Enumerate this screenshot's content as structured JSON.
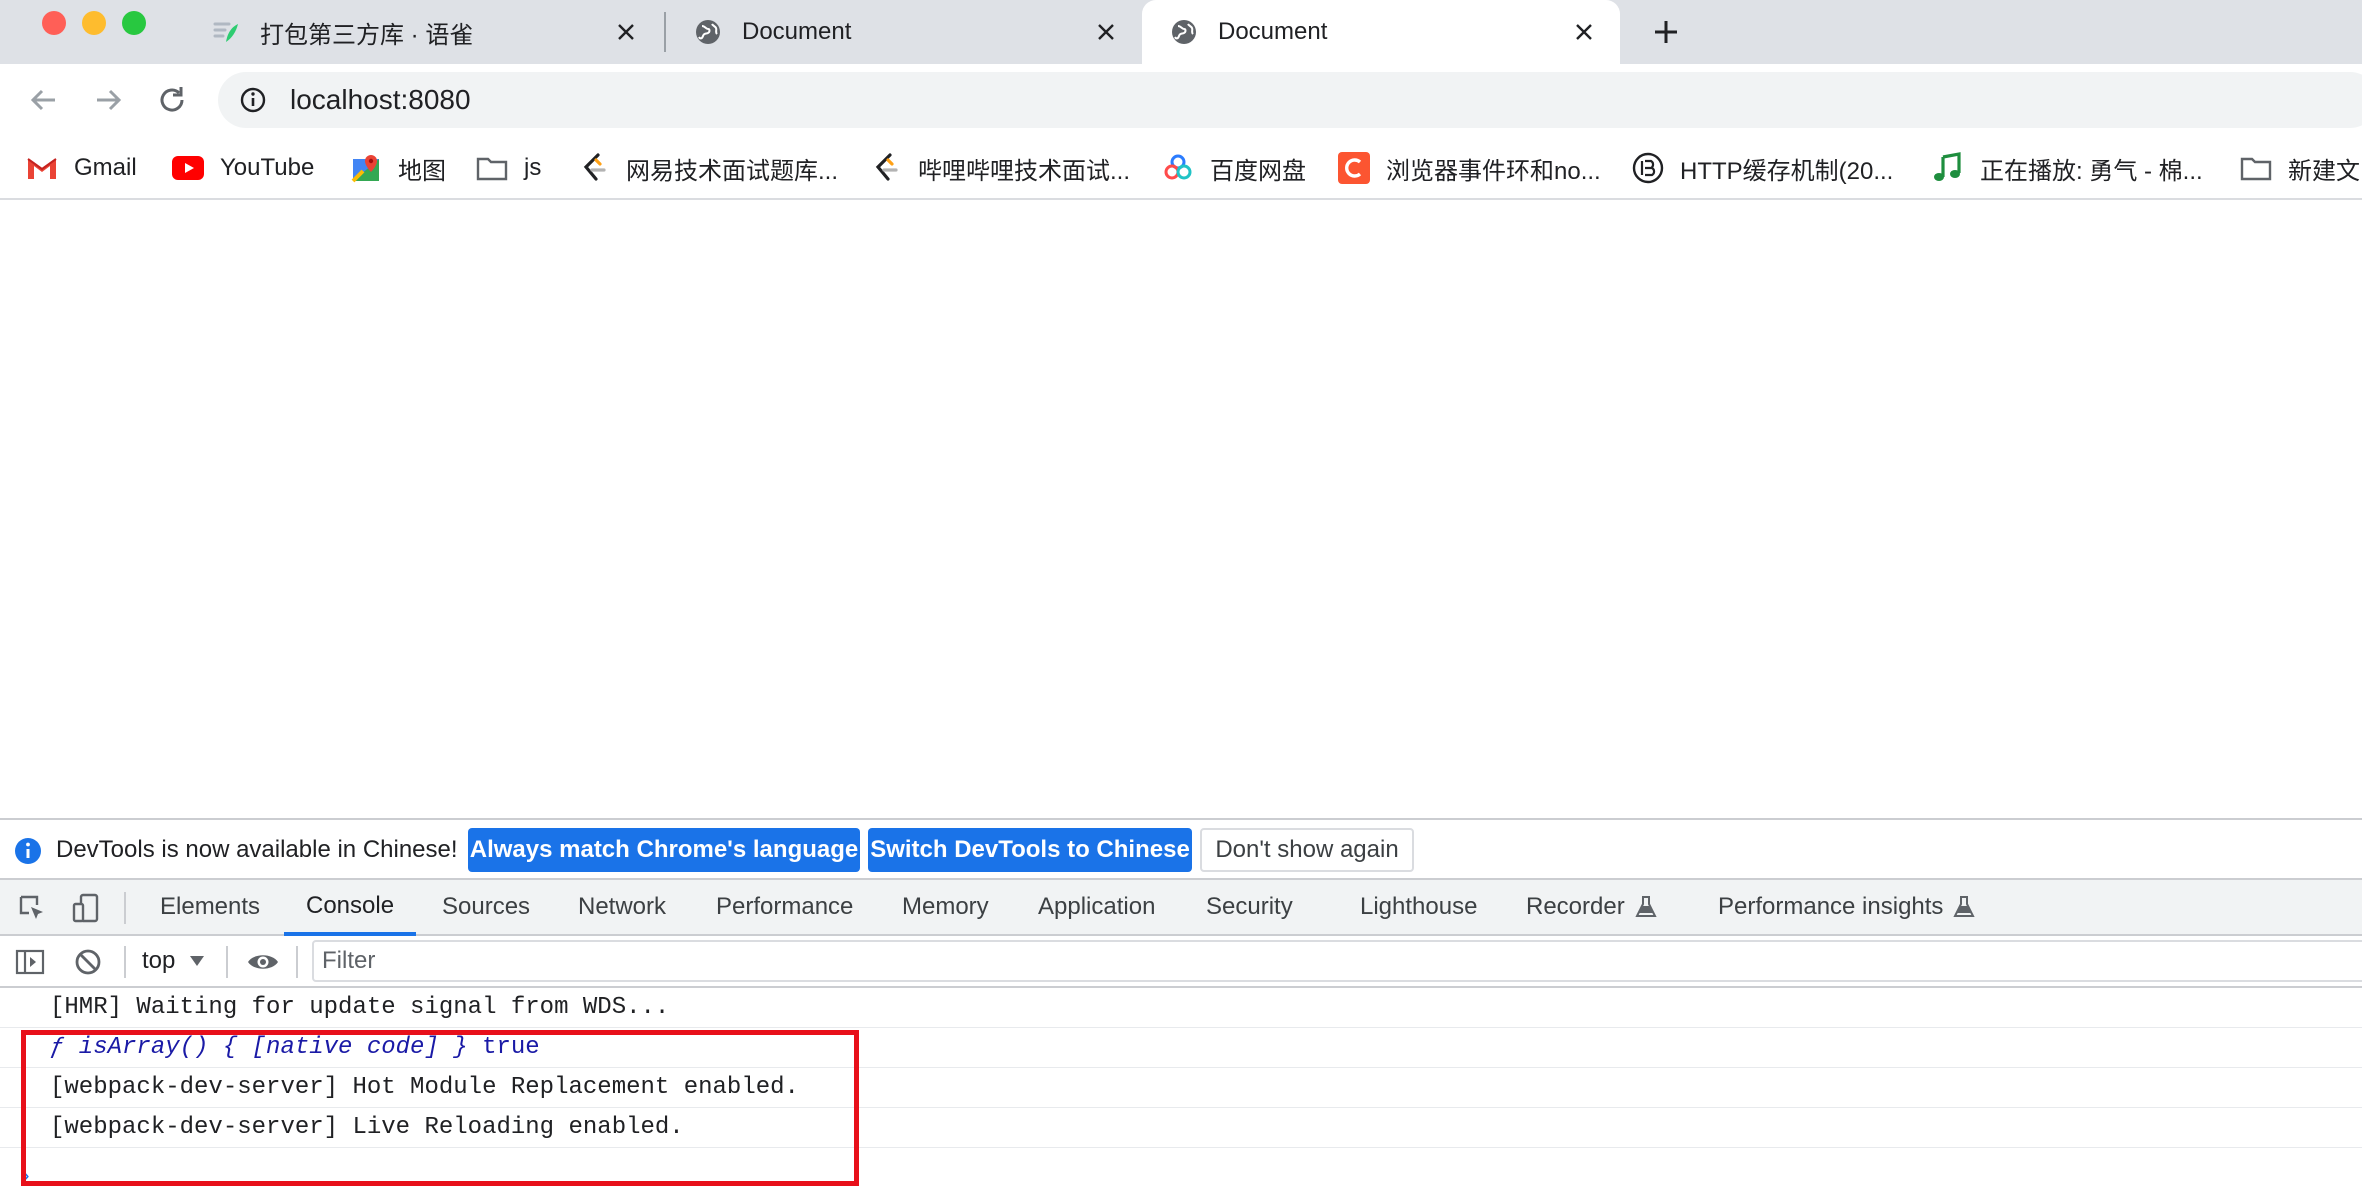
{
  "browser": {
    "tabs": [
      {
        "title": "打包第三方库 · 语雀",
        "icon": "yuque-icon",
        "active": false
      },
      {
        "title": "Document",
        "icon": "globe-icon",
        "active": false
      },
      {
        "title": "Document",
        "icon": "globe-icon",
        "active": true
      }
    ],
    "new_tab_label": "+",
    "address": "localhost:8080",
    "bookmarks": [
      {
        "label": "Gmail",
        "icon": "gmail-icon"
      },
      {
        "label": "YouTube",
        "icon": "youtube-icon"
      },
      {
        "label": "地图",
        "icon": "maps-icon"
      },
      {
        "label": "js",
        "icon": "folder-icon"
      },
      {
        "label": "网易技术面试题库...",
        "icon": "leetcode-icon"
      },
      {
        "label": "哔哩哔哩技术面试...",
        "icon": "leetcode-icon"
      },
      {
        "label": "百度网盘",
        "icon": "baidu-pan-icon"
      },
      {
        "label": "浏览器事件环和no...",
        "icon": "csdn-icon"
      },
      {
        "label": "HTTP缓存机制(20...",
        "icon": "juejin-icon"
      },
      {
        "label": "正在播放: 勇气 - 棉...",
        "icon": "music-icon"
      },
      {
        "label": "新建文",
        "icon": "folder-icon"
      }
    ]
  },
  "devtools": {
    "infobar": {
      "message": "DevTools is now available in Chinese!",
      "buttons": [
        "Always match Chrome's language",
        "Switch DevTools to Chinese",
        "Don't show again"
      ]
    },
    "tabs": [
      "Elements",
      "Console",
      "Sources",
      "Network",
      "Performance",
      "Memory",
      "Application",
      "Security",
      "Lighthouse",
      "Recorder",
      "Performance insights"
    ],
    "active_tab": "Console",
    "context": "top",
    "filter_placeholder": "Filter",
    "console_lines": {
      "line1": "[HMR] Waiting for update signal from WDS...",
      "line2_fn": "ƒ isArray() { [native code] }",
      "line2_value": "true",
      "line3": "[webpack-dev-server] Hot Module Replacement enabled.",
      "line4": "[webpack-dev-server] Live Reloading enabled."
    },
    "prompt": "›"
  },
  "colors": {
    "accent": "#1a73e8",
    "highlight": "#e8101a",
    "tabstrip": "#dee1e6"
  }
}
